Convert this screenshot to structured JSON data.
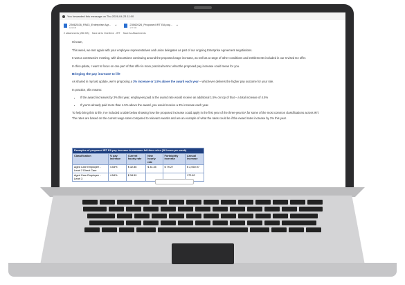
{
  "email": {
    "forward_notice": "You forwarded this message on Thu 2026-04-23 11:00",
    "attachments": [
      {
        "name": "23062026_PA03_Enterprise Agr...",
        "size": "103 KB"
      },
      {
        "name": "23062026_Proposed IRT EA pay...",
        "size": "177 KB"
      }
    ],
    "attachment_actions": {
      "count": "2 attachments (286 KB)",
      "save_onedrive": "Save all to OneDrive - IRT",
      "download": "Save As Attachments"
    },
    "greeting": "Hi team,",
    "para1": "This week, we met again with your employee representatives and union delegates as part of our ongoing Enterprise Agreement negotiations.",
    "para2": "It was a constructive meeting, with discussions continuing around the proposed wage increase, as well as a range of other conditions and entitlements included in our revised EA offer.",
    "para3": "In this update, I want to focus on one part of that offer in more practical terms: what the proposed pay increase could mean for you.",
    "heading": "Bringing the pay increase to life",
    "para4_pre": "As shared in my last update, we're proposing a ",
    "para4_bold": "3% increase or 1.5% above the award each year",
    "para4_post": " – whichever delivers the higher pay outcome for your role.",
    "para5": "In practice, this means:",
    "bullet1": "If the award increases by 3% this year, employees paid at the award rate would receive an additional 1.5% on top of that – a total increase of 4.5%",
    "bullet2": "If you're already paid more than 1.5% above the award, you would receive a 3% increase each year.",
    "para6": "To help bring this to life, I've included a table below showing how the proposed increase could apply in the first year of the three-year EA for some of the most common classifications across IRT.",
    "para7": "The rates are based on the current wage rates compared to relevant Awards and are an example of what the rates could be if the Award rates increase by 3% this year."
  },
  "table": {
    "caption": "Examples of proposed IRT EA pay increase to common full-time roles (38 hours per week)",
    "headers": [
      "Classification",
      "% pay increase",
      "Current hourly rate",
      "New hourly rate",
      "Fortnightly increase",
      "Annual increase"
    ],
    "rows": [
      [
        "Aged Care Employee - Level 2 Direct Care",
        "4.53%",
        "$ 32.86",
        "$ 34.35",
        "$ 79.27",
        "$ 2,060.97"
      ],
      [
        "Aged Care Employee - Level 3",
        "4.54%",
        "$ 34.59",
        "",
        "",
        "172.62"
      ]
    ]
  }
}
